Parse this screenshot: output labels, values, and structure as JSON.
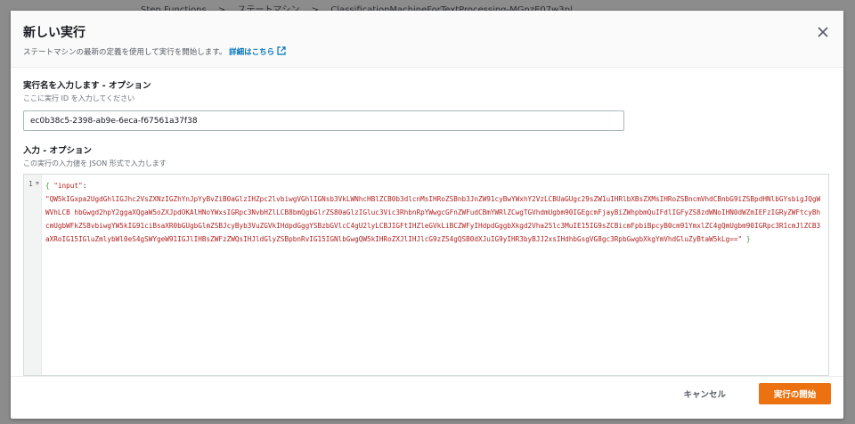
{
  "background": {
    "breadcrumbs": [
      "Step Functions",
      "ステートマシン",
      "ClassificationMachineForTextProcessing-MGnzE07w3pl"
    ]
  },
  "modal": {
    "title": "新しい実行",
    "description": "ステートマシンの最新の定義を使用して実行を開始します。",
    "details_link": "詳細はこちら",
    "name_label": "実行名を入力します - オプション",
    "name_description": "ここに実行 ID を入力してください",
    "name_value": "ec0b38c5-2398-ab9e-6eca-f67561a37f38",
    "input_label": "入力 - オプション",
    "input_description": "この実行の入力値を JSON 形式で入力します",
    "editor": {
      "line_number": "1",
      "open_brace": "{",
      "key": "\"input\"",
      "colon": ":",
      "value": "\"QW5kIGxpa2UgdGhlIGJhc2VsZXNzIGZhYnJpYyBvZiB0aGlzIHZpc2lvbiwgVGhlIGNsb3VkLWNhcHBlZCB0b3dlcnMsIHRoZSBnb3JnZW91cyBwYWxhY2VzLCBUaGUgc29sZW1uIHRlbXBsZXMsIHRoZSBncmVhdCBnbG9iZSBpdHNlbGYsbigJQgWWVhLCB hbGwgd2hpY2ggaXQgaW5oZXJpdOKAlHNoYWxsIGRpc3NvbHZlLCB8bmQgbGlrZS80aGlzIGluc3Vic3RhbnRpYWwgcGFnZWFudCBmYWRlZCwgTGVhdmUgbm90IGEgcmFjayBiZWhpbmQuIFdlIGFyZS8zdWNoIHN0dWZmIEFzIGRyZWFtcyBhcmUgbWFkZS8vbiwgYW5kIG91ciBsaXR0bGUgbGlmZSBJcyByb3VuZGVkIHdpdGggYSBzbGVlcC4gU2lyLCBJIGFtIHZleGVkLiBCZWFyIHdpdGggbXkgd2Vha25lc3MuIE15IG9sZCBicmFpbiBpcyB0cm91YmxlZC4gQmUgbm90IGRpc3R1cmJlZCB3aXRoIG15IGluZmlybWl0eS4gSWYgeW91IGJlIHBsZWFzZWQsIHJldGlyZSBpbnRvIG15IGNlbGwgQW5kIHRoZXJlIHJlcG9zZS4gQSB0dXJuIG9yIHR3byBJJ2xsIHdhbGsgVG8gc3RpbGwgbXkgYmVhdGluZyBtaW5kLg==\"",
      "close_brace": "}"
    },
    "cancel_label": "キャンセル",
    "start_label": "実行の開始"
  }
}
